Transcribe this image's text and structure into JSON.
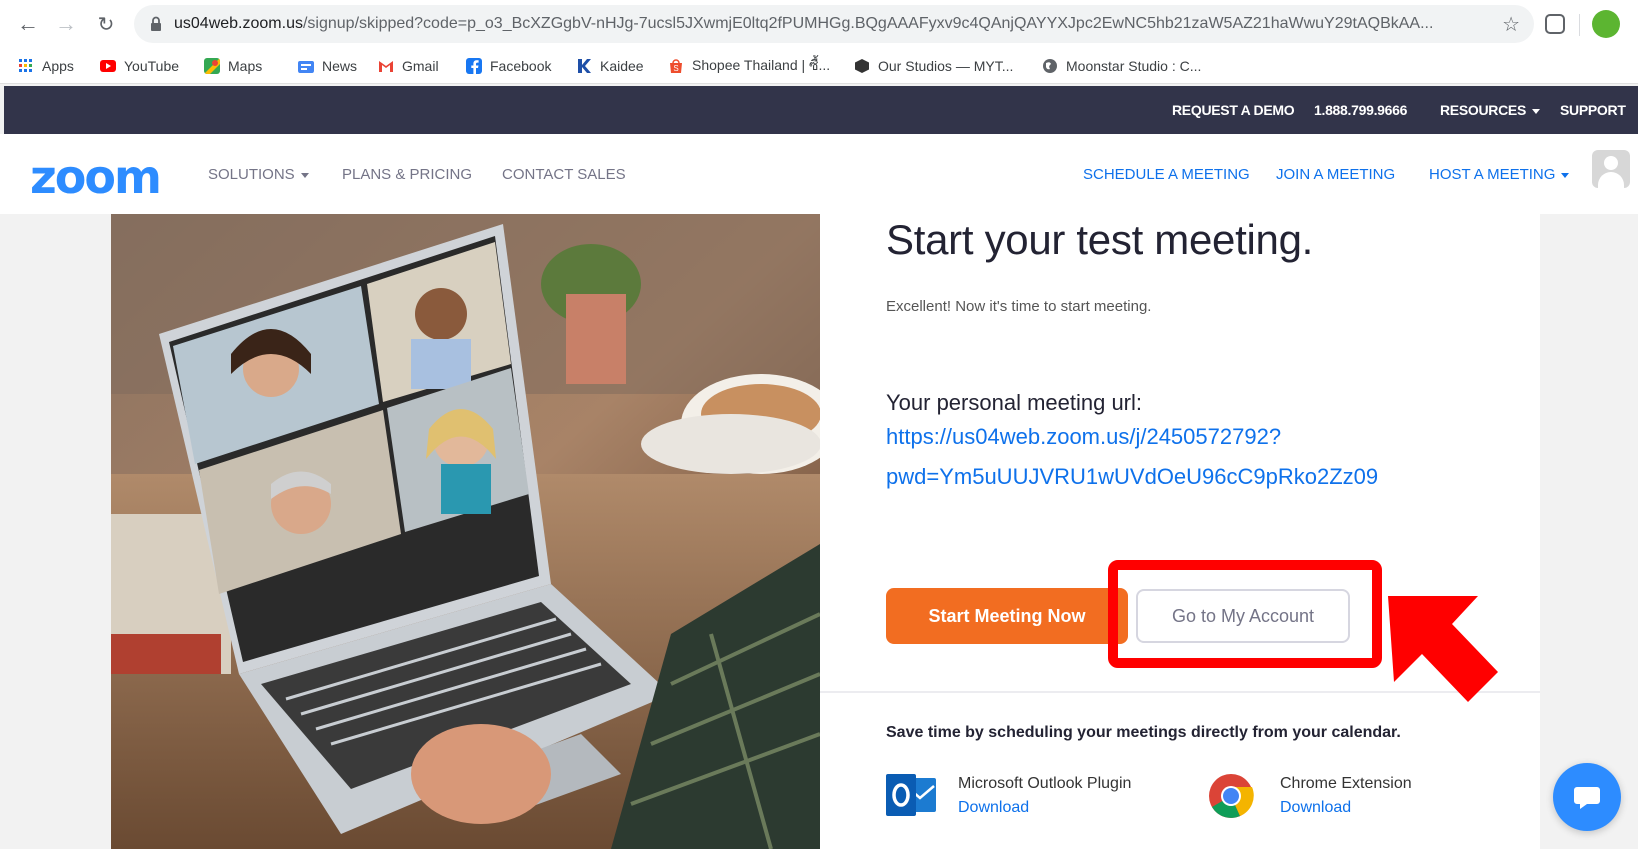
{
  "browser": {
    "url_host": "us04web.zoom.us",
    "url_path": "/signup/skipped?code=p_o3_BcXZGgbV-nHJg-7ucsl5JXwmjE0ltq2fPUMHGg.BQgAAAFyxv9c4QAnjQAYYXJpc2EwNC5hb21zaW5AZ21haWwuY29tAQBkAA...",
    "bookmarks": [
      {
        "label": "Apps",
        "icon": "apps-grid-icon",
        "color": "#1a73e8"
      },
      {
        "label": "YouTube",
        "icon": "youtube-icon",
        "color": "#ff0000"
      },
      {
        "label": "Maps",
        "icon": "maps-icon",
        "color": "#34a853"
      },
      {
        "label": "News",
        "icon": "news-icon",
        "color": "#4285f4"
      },
      {
        "label": "Gmail",
        "icon": "gmail-icon",
        "color": "#ea4335"
      },
      {
        "label": "Facebook",
        "icon": "facebook-icon",
        "color": "#1877f2"
      },
      {
        "label": "Kaidee",
        "icon": "kaidee-icon",
        "color": "#1e4fa8"
      },
      {
        "label": "Shopee Thailand | ซื้...",
        "icon": "shopee-icon",
        "color": "#ee4d2d"
      },
      {
        "label": "Our Studios — MYT...",
        "icon": "box-icon",
        "color": "#333333"
      },
      {
        "label": "Moonstar Studio : C...",
        "icon": "globe-icon",
        "color": "#5f6368"
      }
    ]
  },
  "topbar": {
    "request_demo": "REQUEST A DEMO",
    "phone": "1.888.799.9666",
    "resources": "RESOURCES",
    "support": "SUPPORT"
  },
  "nav": {
    "logo": "zoom",
    "solutions": "SOLUTIONS",
    "plans": "PLANS & PRICING",
    "contact": "CONTACT SALES",
    "schedule": "SCHEDULE A MEETING",
    "join": "JOIN A MEETING",
    "host": "HOST A MEETING"
  },
  "main": {
    "title": "Start your test meeting.",
    "subtitle": "Excellent! Now it's time to start meeting.",
    "url_label": "Your personal meeting url:",
    "url_line1": "https://us04web.zoom.us/j/2450572792?",
    "url_line2": "pwd=Ym5uUUJVRU1wUVdOeU96cC9pRko2Zz09",
    "start_button": "Start Meeting Now",
    "account_button": "Go to My Account",
    "calendar_note": "Save time by scheduling your meetings directly from your calendar.",
    "outlook_title": "Microsoft Outlook Plugin",
    "outlook_link": "Download",
    "chrome_title": "Chrome Extension",
    "chrome_link": "Download"
  },
  "colors": {
    "zoom_blue": "#2d8cff",
    "start_orange": "#f26d21",
    "highlight_red": "#ff0000",
    "topbar_navy": "#32344a"
  }
}
